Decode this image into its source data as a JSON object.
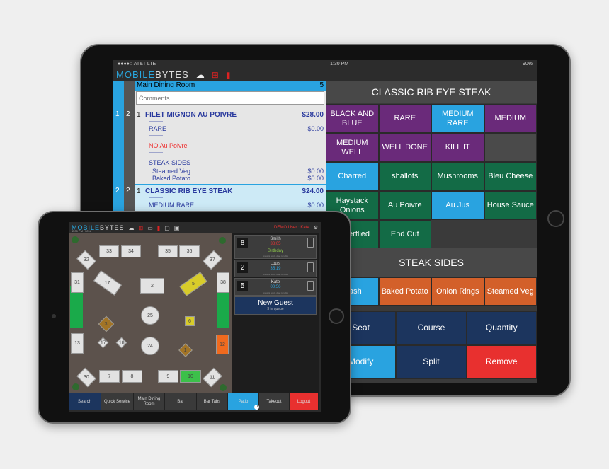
{
  "big_screen": {
    "status": {
      "carrier": "●●●●○ AT&T  LTE",
      "time": "1:30 PM",
      "battery": "90%"
    },
    "logo": {
      "part1": "MOBILE",
      "part2": "BYTES"
    },
    "order": {
      "room": "Main Dining Room",
      "guests": "5",
      "comments_placeholder": "Comments",
      "items": [
        {
          "seat": "1",
          "course": "2",
          "qty": "1",
          "name": "FILET MIGNON AU POIVRE",
          "price": "$28.00",
          "mods": [
            {
              "text": "----------",
              "price": ""
            },
            {
              "text": "RARE",
              "price": "$0.00"
            },
            {
              "text": "----------",
              "price": ""
            },
            {
              "text": "NO Au Poivre",
              "price": ""
            },
            {
              "text": "----------",
              "price": ""
            },
            {
              "text": "STEAK SIDES",
              "price": ""
            },
            {
              "text": "Steamed Veg",
              "price": "$0.00"
            },
            {
              "text": "Baked Potato",
              "price": "$0.00"
            }
          ]
        },
        {
          "seat": "2",
          "course": "2",
          "qty": "1",
          "name": "CLASSIC RIB EYE STEAK",
          "price": "$24.00",
          "mods": [
            {
              "text": "----------",
              "price": ""
            },
            {
              "text": "MEDIUM RARE",
              "price": "$0.00"
            }
          ]
        }
      ]
    },
    "modifier_title": "CLASSIC RIB EYE STEAK",
    "modifiers": [
      "BLACK AND BLUE",
      "RARE",
      "MEDIUM RARE",
      "MEDIUM",
      "MEDIUM WELL",
      "WELL DONE",
      "KILL IT",
      "",
      "Charred",
      "shallots",
      "Mushrooms",
      "Bleu Cheese",
      "Haystack Onions",
      "Au Poivre",
      "Au Jus",
      "House Sauce",
      "Butterflied",
      "End Cut"
    ],
    "sides_title": "STEAK SIDES",
    "sides": [
      "Mash",
      "Baked Potato",
      "Onion Rings",
      "Steamed Veg"
    ],
    "actions": [
      "Seat",
      "Course",
      "Quantity",
      "Modify",
      "Split",
      "Remove"
    ]
  },
  "small_screen": {
    "logo": {
      "part1": "MOBILE",
      "part2": "BYTES"
    },
    "status": "2:05 PM | 30%",
    "user": "DEMO User : Kate",
    "tables": [
      "33",
      "34",
      "35",
      "36",
      "32",
      "37",
      "31",
      "38",
      "17",
      "2",
      "5",
      "25",
      "3",
      "6",
      "24",
      "1",
      "13",
      "12",
      "17",
      "18",
      "30",
      "11",
      "7",
      "8",
      "9",
      "10"
    ],
    "queue": [
      {
        "party": "8",
        "name": "Smith",
        "time": "38:05",
        "note": "Birthday",
        "hint": "press & hold - drag to table"
      },
      {
        "party": "2",
        "name": "Louis",
        "time": "35:19",
        "note": "",
        "hint": "press & hold - drag to table"
      },
      {
        "party": "5",
        "name": "Kate",
        "time": "00:56",
        "note": "",
        "hint": "press & hold - drag to table"
      }
    ],
    "new_guest": {
      "label": "New Guest",
      "queue": "3 in queue"
    },
    "tabs": [
      "Search",
      "Quick Service",
      "Main Dining Room",
      "Bar",
      "Bar Tabs",
      "Patio",
      "Takeout",
      "Logout"
    ],
    "patio_badge": "0"
  },
  "colors": {
    "accent": "#29a3e0",
    "purple": "#6a2a7a",
    "green": "#136b46",
    "orange": "#d3602a",
    "navy": "#1c355e",
    "red": "#e8302f"
  }
}
